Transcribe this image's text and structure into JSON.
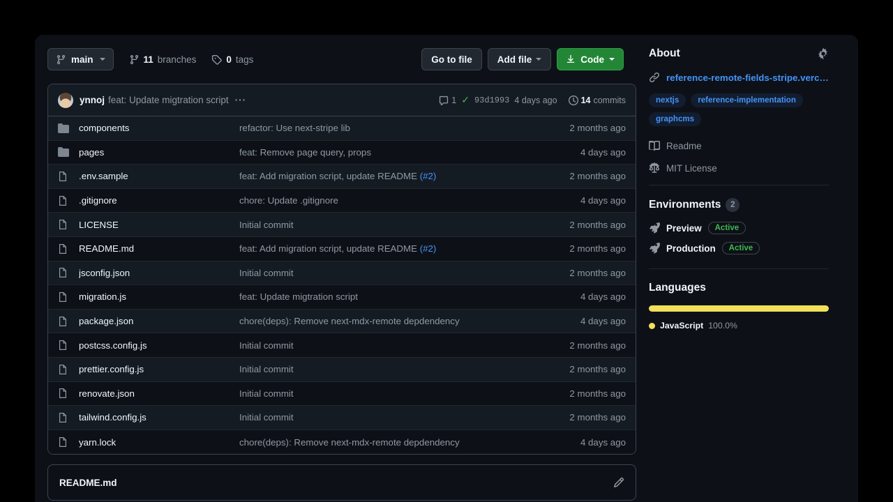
{
  "toolbar": {
    "branch": "main",
    "branches_count": "11",
    "branches_label": "branches",
    "tags_count": "0",
    "tags_label": "tags",
    "go_to_file": "Go to file",
    "add_file": "Add file",
    "code": "Code"
  },
  "commit_bar": {
    "author": "ynnoj",
    "message": "feat: Update migtration script",
    "dots": "···",
    "comments_count": "1",
    "status_check": "✓",
    "hash": "93d1993",
    "time": "4 days ago",
    "commits_count": "14",
    "commits_label": "commits"
  },
  "files": [
    {
      "icon": "folder-icon",
      "name": "components",
      "message": "refactor: Use next-stripe lib",
      "issue": "",
      "time": "2 months ago"
    },
    {
      "icon": "folder-icon",
      "name": "pages",
      "message": "feat: Remove page query, props",
      "issue": "",
      "time": "4 days ago"
    },
    {
      "icon": "file-icon",
      "name": ".env.sample",
      "message": "feat: Add migration script, update README ",
      "issue": "(#2)",
      "time": "2 months ago"
    },
    {
      "icon": "file-icon",
      "name": ".gitignore",
      "message": "chore: Update .gitignore",
      "issue": "",
      "time": "4 days ago"
    },
    {
      "icon": "file-icon",
      "name": "LICENSE",
      "message": "Initial commit",
      "issue": "",
      "time": "2 months ago"
    },
    {
      "icon": "file-icon",
      "name": "README.md",
      "message": "feat: Add migration script, update README ",
      "issue": "(#2)",
      "time": "2 months ago"
    },
    {
      "icon": "file-icon",
      "name": "jsconfig.json",
      "message": "Initial commit",
      "issue": "",
      "time": "2 months ago"
    },
    {
      "icon": "file-icon",
      "name": "migration.js",
      "message": "feat: Update migtration script",
      "issue": "",
      "time": "4 days ago"
    },
    {
      "icon": "file-icon",
      "name": "package.json",
      "message": "chore(deps): Remove next-mdx-remote depdendency",
      "issue": "",
      "time": "4 days ago"
    },
    {
      "icon": "file-icon",
      "name": "postcss.config.js",
      "message": "Initial commit",
      "issue": "",
      "time": "2 months ago"
    },
    {
      "icon": "file-icon",
      "name": "prettier.config.js",
      "message": "Initial commit",
      "issue": "",
      "time": "2 months ago"
    },
    {
      "icon": "file-icon",
      "name": "renovate.json",
      "message": "Initial commit",
      "issue": "",
      "time": "2 months ago"
    },
    {
      "icon": "file-icon",
      "name": "tailwind.config.js",
      "message": "Initial commit",
      "issue": "",
      "time": "2 months ago"
    },
    {
      "icon": "file-icon",
      "name": "yarn.lock",
      "message": "chore(deps): Remove next-mdx-remote depdendency",
      "issue": "",
      "time": "4 days ago"
    }
  ],
  "readme": {
    "title": "README.md"
  },
  "about": {
    "title": "About",
    "homepage": "reference-remote-fields-stripe.vercel.a…",
    "topics": [
      "nextjs",
      "reference-implementation",
      "graphcms"
    ],
    "readme_link": "Readme",
    "license_link": "MIT License"
  },
  "environments": {
    "title": "Environments",
    "count": "2",
    "items": [
      {
        "name": "Preview",
        "status": "Active"
      },
      {
        "name": "Production",
        "status": "Active"
      }
    ]
  },
  "languages": {
    "title": "Languages",
    "items": [
      {
        "name": "JavaScript",
        "percent": "100.0%",
        "color": "#f1e05a",
        "width": "100%"
      }
    ]
  },
  "colors": {
    "accent_blue": "#4493f8",
    "green": "#238636",
    "active_green": "#3fb950",
    "javascript": "#f1e05a",
    "page_bg": "#0d1117",
    "muted": "#9198a1"
  }
}
